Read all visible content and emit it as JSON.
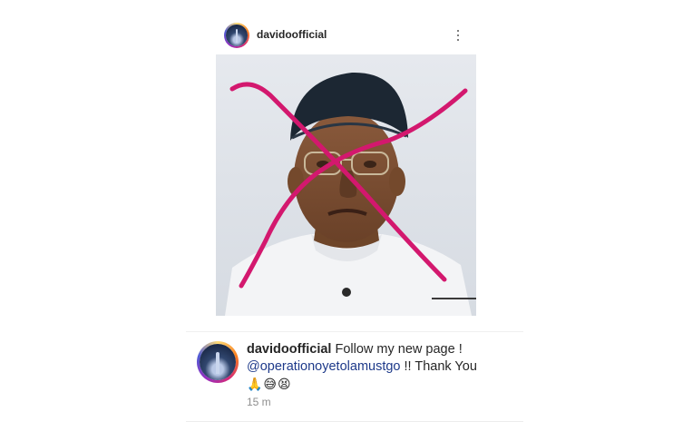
{
  "post": {
    "username": "davidoofficial"
  },
  "comment": {
    "username": "davidoofficial",
    "text_before": "Follow my new page !",
    "mention": "@operationoyetolamustgo",
    "text_after": "!! Thank You",
    "emojis": "🙏😅😫",
    "timestamp": "15 m"
  },
  "colors": {
    "x_mark": "#d3186e",
    "mention": "#1e3a8a",
    "timestamp": "#8e8e8e"
  },
  "icons": {
    "more": "more-vertical-icon"
  }
}
